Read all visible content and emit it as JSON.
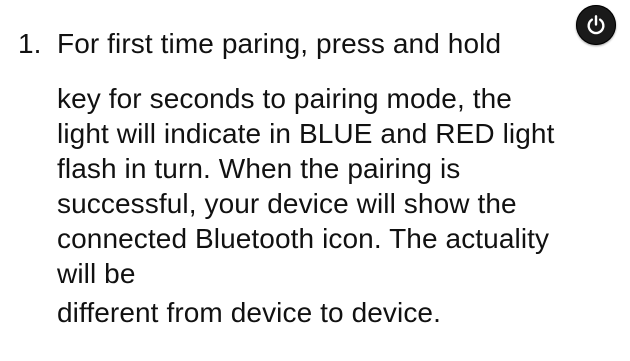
{
  "step": {
    "number": "1.",
    "lines": [
      "For first time paring, press and hold",
      "key for seconds to pairing mode, the",
      "light will indicate in BLUE and RED light",
      "flash in turn. When the pairing is",
      "successful, your device will show the",
      "connected Bluetooth icon. The actuality",
      "will be",
      "different from device to device."
    ],
    "icon": "power-icon"
  }
}
